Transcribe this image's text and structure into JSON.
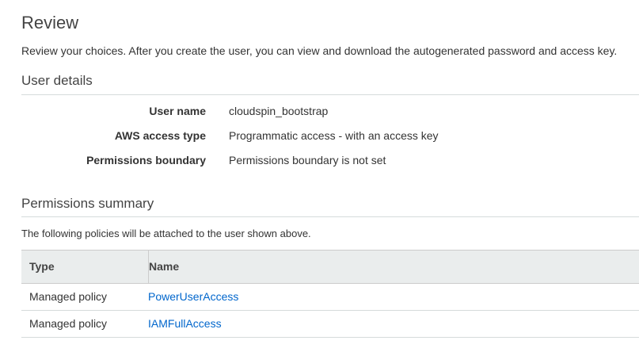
{
  "header": {
    "title": "Review",
    "intro": "Review your choices. After you create the user, you can view and download the autogenerated password and access key."
  },
  "user_details": {
    "section_title": "User details",
    "rows": [
      {
        "label": "User name",
        "value": "cloudspin_bootstrap"
      },
      {
        "label": "AWS access type",
        "value": "Programmatic access - with an access key"
      },
      {
        "label": "Permissions boundary",
        "value": "Permissions boundary is not set"
      }
    ]
  },
  "permissions_summary": {
    "section_title": "Permissions summary",
    "description": "The following policies will be attached to the user shown above.",
    "columns": {
      "type": "Type",
      "name": "Name"
    },
    "rows": [
      {
        "type": "Managed policy",
        "name": "PowerUserAccess"
      },
      {
        "type": "Managed policy",
        "name": "IAMFullAccess"
      }
    ]
  },
  "colors": {
    "link": "#0066cc",
    "table_header_bg": "#eaeded",
    "rule": "#d5dbdb"
  }
}
